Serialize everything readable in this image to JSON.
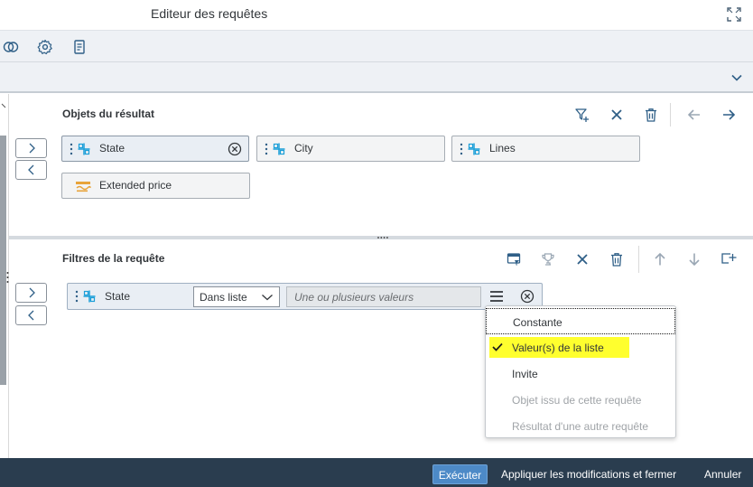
{
  "window": {
    "title": "Editeur des requêtes"
  },
  "toolbar": {
    "icons": [
      "combine-queries-icon",
      "settings-gear-icon",
      "query-script-icon"
    ]
  },
  "result_objects": {
    "title": "Objets du résultat",
    "actions": [
      "add-filter-icon",
      "clear-icon",
      "delete-icon",
      "move-left-icon",
      "move-right-icon"
    ],
    "items": [
      {
        "label": "State",
        "type": "dimension",
        "selected": true
      },
      {
        "label": "City",
        "type": "dimension",
        "selected": false
      },
      {
        "label": "Lines",
        "type": "dimension",
        "selected": false
      },
      {
        "label": "Extended price",
        "type": "measure",
        "selected": false
      }
    ]
  },
  "query_filters": {
    "title": "Filtres de la requête",
    "actions": [
      "filter-panel-icon",
      "trophy-icon",
      "clear-icon",
      "delete-icon",
      "move-up-icon",
      "move-down-icon",
      "add-subquery-icon"
    ],
    "filter": {
      "object": "State",
      "operator": "Dans liste",
      "values_placeholder": "Une ou plusieurs valeurs"
    }
  },
  "operand_menu": {
    "items": [
      {
        "label": "Constante",
        "state": "focused"
      },
      {
        "label": "Valeur(s) de la liste",
        "state": "checked"
      },
      {
        "label": "Invite",
        "state": "normal"
      },
      {
        "label": "Objet issu de cette requête",
        "state": "disabled"
      },
      {
        "label": "Résultat d'une autre requête",
        "state": "disabled"
      }
    ]
  },
  "footer": {
    "run_label": "Exécuter",
    "apply_label": "Appliquer les modifications et fermer",
    "cancel_label": "Annuler"
  },
  "colors": {
    "accent": "#0a6ed1",
    "dimension_icon": "#1a9ed8",
    "measure_icon": "#e8a33a",
    "footer_bg": "#2a3d4f",
    "run_button": "#4d8ac7",
    "highlight": "#ffff2e"
  }
}
